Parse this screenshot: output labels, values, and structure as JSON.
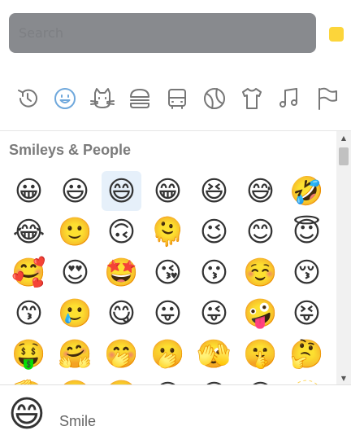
{
  "search": {
    "placeholder": "Search"
  },
  "skin_tone": {
    "color": "#fcd53a"
  },
  "categories": [
    {
      "icon": "recent-icon",
      "label": "Recent"
    },
    {
      "icon": "smiley-icon",
      "label": "Smileys & People",
      "active": true
    },
    {
      "icon": "cat-icon",
      "label": "Animals & Nature"
    },
    {
      "icon": "burger-icon",
      "label": "Food & Drink"
    },
    {
      "icon": "bus-icon",
      "label": "Travel & Places"
    },
    {
      "icon": "ball-icon",
      "label": "Activities"
    },
    {
      "icon": "shirt-icon",
      "label": "Objects"
    },
    {
      "icon": "music-icon",
      "label": "Symbols"
    },
    {
      "icon": "flag-icon",
      "label": "Flags"
    }
  ],
  "section": {
    "title": "Smileys & People"
  },
  "emojis": [
    "😀",
    "😃",
    "😄",
    "😁",
    "😆",
    "😅",
    "🤣",
    "😂",
    "🙂",
    "🙃",
    "🫠",
    "😉",
    "😊",
    "😇",
    "🥰",
    "😍",
    "🤩",
    "😘",
    "😗",
    "☺️",
    "😚",
    "😙",
    "🥲",
    "😋",
    "😛",
    "😜",
    "🤪",
    "😝",
    "🤑",
    "🤗",
    "🤭",
    "🫢",
    "🫣",
    "🤫",
    "🤔",
    "🫡",
    "🤐",
    "🤨",
    "😐",
    "😑",
    "😶",
    "🫥"
  ],
  "selected_index": 2,
  "preview": {
    "emoji": "😄",
    "name": "Smile"
  }
}
